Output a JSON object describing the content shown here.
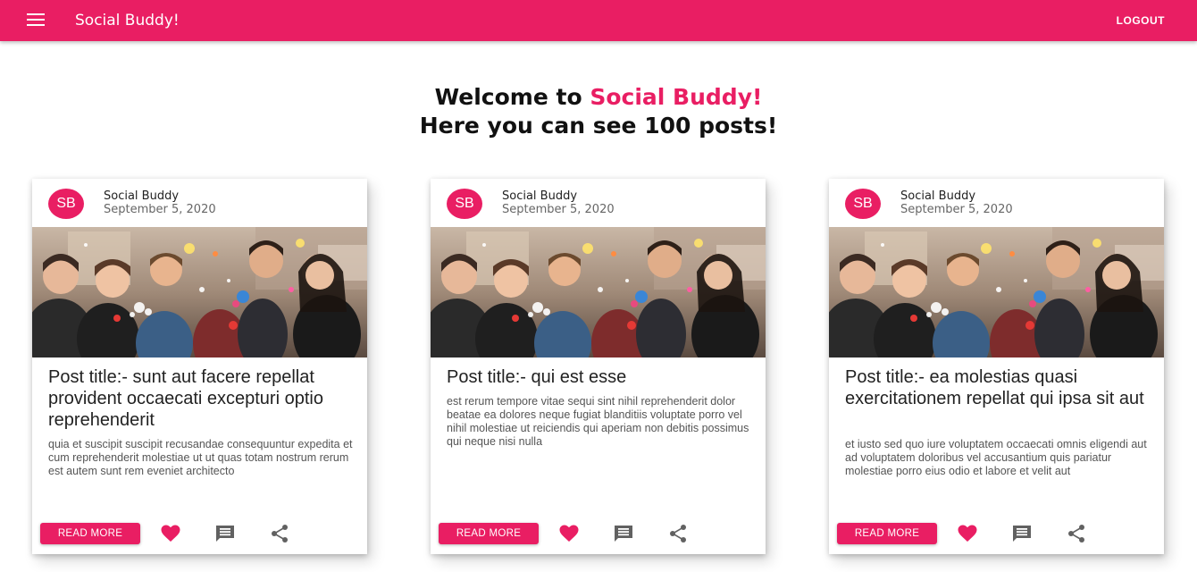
{
  "appbar": {
    "title": "Social Buddy!",
    "logout_label": "LOGOUT",
    "menu_icon": "menu-icon"
  },
  "welcome": {
    "line1_prefix": "Welcome to ",
    "line1_accent": "Social Buddy!",
    "line2": "Here you can see 100 posts!"
  },
  "colors": {
    "accent": "#e91e63",
    "heart": "#e91e63",
    "icon_grey": "#616161"
  },
  "posts": [
    {
      "avatar": "SB",
      "author": "Social Buddy",
      "date": "September 5, 2020",
      "title": "Post title:- sunt aut facere repellat provident occaecati excepturi optio reprehenderit",
      "body": "quia et suscipit suscipit recusandae consequuntur expedita et cum reprehenderit molestiae ut ut quas totam nostrum rerum est autem sunt rem eveniet architecto",
      "read_more": "READ MORE"
    },
    {
      "avatar": "SB",
      "author": "Social Buddy",
      "date": "September 5, 2020",
      "title": "Post title:- qui est esse",
      "body": "est rerum tempore vitae sequi sint nihil reprehenderit dolor beatae ea dolores neque fugiat blanditiis voluptate porro vel nihil molestiae ut reiciendis qui aperiam non debitis possimus qui neque nisi nulla",
      "read_more": "READ MORE"
    },
    {
      "avatar": "SB",
      "author": "Social Buddy",
      "date": "September 5, 2020",
      "title": "Post title:- ea molestias quasi exercitationem repellat qui ipsa sit aut",
      "body": "et iusto sed quo iure voluptatem occaecati omnis eligendi aut ad voluptatem doloribus vel accusantium quis pariatur molestiae porro eius odio et labore et velit aut",
      "read_more": "READ MORE"
    }
  ]
}
